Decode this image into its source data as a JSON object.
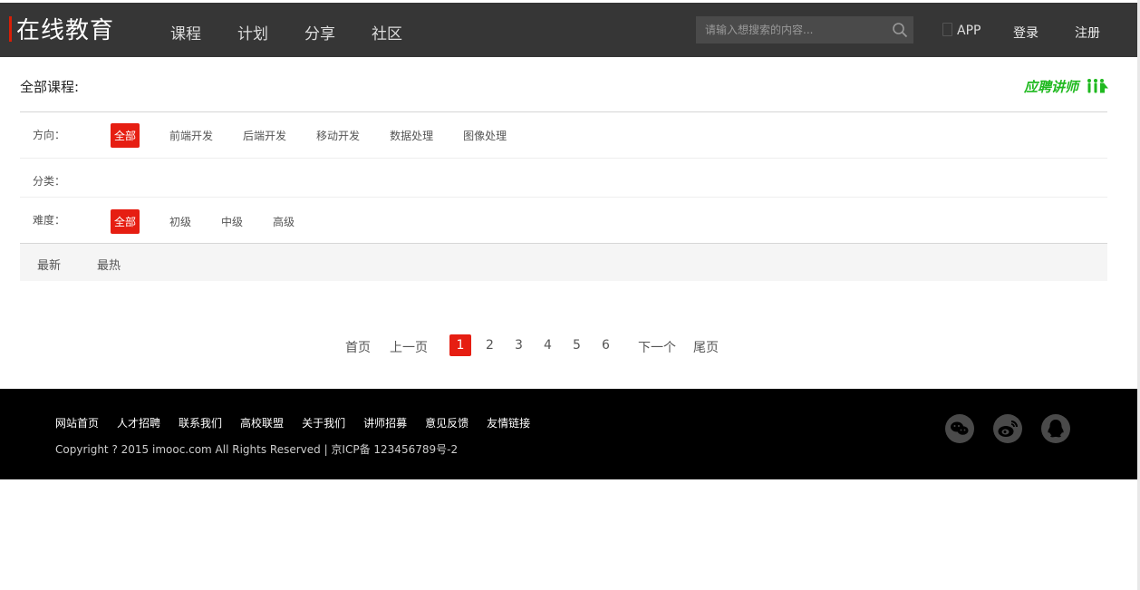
{
  "header": {
    "logo": "在线教育",
    "nav": [
      "课程",
      "计划",
      "分享",
      "社区"
    ],
    "search_placeholder": "请输入想搜索的内容...",
    "app_label": "APP",
    "login": "登录",
    "register": "注册"
  },
  "main": {
    "title": "全部课程:",
    "recruit": "应聘讲师"
  },
  "filters": {
    "direction": {
      "label": "方向：",
      "options": [
        "全部",
        "前端开发",
        "后端开发",
        "移动开发",
        "数据处理",
        "图像处理"
      ]
    },
    "category": {
      "label": "分类："
    },
    "difficulty": {
      "label": "难度：",
      "options": [
        "全部",
        "初级",
        "中级",
        "高级"
      ]
    }
  },
  "sort": [
    "最新",
    "最热"
  ],
  "pagination": {
    "first": "首页",
    "prev": "上一页",
    "pages": [
      "1",
      "2",
      "3",
      "4",
      "5",
      "6"
    ],
    "next": "下一个",
    "last": "尾页"
  },
  "footer": {
    "links": [
      "网站首页",
      "人才招聘",
      "联系我们",
      "高校联盟",
      "关于我们",
      "讲师招募",
      "意见反馈",
      "友情链接"
    ],
    "copyright": "Copyright ? 2015 imooc.com All Rights Reserved | 京ICP备 123456789号-2"
  },
  "colors": {
    "header_bg": "#363636",
    "accent": "#e61e12",
    "recruit": "#1fb91f",
    "footer_bg": "#000000"
  },
  "icons": [
    "search-icon",
    "phone-icon",
    "recruit-people-icon",
    "wechat-icon",
    "weibo-icon",
    "qq-icon"
  ]
}
